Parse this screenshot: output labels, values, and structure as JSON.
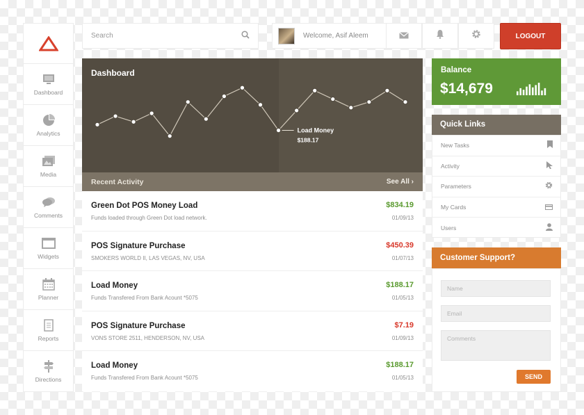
{
  "sidebar": {
    "items": [
      {
        "label": "Dashboard",
        "icon": "monitor-icon"
      },
      {
        "label": "Analytics",
        "icon": "pie-chart-icon"
      },
      {
        "label": "Media",
        "icon": "image-icon"
      },
      {
        "label": "Comments",
        "icon": "comments-icon"
      },
      {
        "label": "Widgets",
        "icon": "window-icon"
      },
      {
        "label": "Planner",
        "icon": "calendar-icon"
      },
      {
        "label": "Reports",
        "icon": "document-icon"
      },
      {
        "label": "Directions",
        "icon": "signpost-icon"
      }
    ]
  },
  "search": {
    "placeholder": "Search"
  },
  "user": {
    "welcome": "Welcome, Asif Aleem"
  },
  "header": {
    "logout_label": "LOGOUT"
  },
  "dashboard": {
    "title": "Dashboard",
    "tooltip_label": "Load Money",
    "tooltip_value": "$188.17"
  },
  "chart_data": {
    "type": "line",
    "series": [
      {
        "values": [
          40,
          55,
          45,
          60,
          20,
          80,
          50,
          90,
          105,
          75,
          30,
          65,
          100,
          85,
          70,
          80,
          100,
          80
        ]
      }
    ],
    "ylim": [
      0,
      120
    ],
    "highlight_index": 10,
    "grid": false
  },
  "recent": {
    "title": "Recent Activity",
    "see_all": "See All",
    "rows": [
      {
        "title": "Green Dot POS Money Load",
        "sub": "Funds loaded through Green Dot load network.",
        "amount": "$834.19",
        "date": "01/09/13",
        "color": "#5a9a2f"
      },
      {
        "title": "POS Signature Purchase",
        "sub": "SMOKERS WORLD II, LAS VEGAS, NV, USA",
        "amount": "$450.39",
        "date": "01/07/13",
        "color": "#d8382a"
      },
      {
        "title": "Load Money",
        "sub": "Funds Transfered From Bank Acount *5075",
        "amount": "$188.17",
        "date": "01/05/13",
        "color": "#5a9a2f"
      },
      {
        "title": "POS Signature Purchase",
        "sub": "VONS STORE 2511, HENDERSON, NV, USA",
        "amount": "$7.19",
        "date": "01/09/13",
        "color": "#d8382a"
      },
      {
        "title": "Load Money",
        "sub": "Funds Transfered From Bank Acount *5075",
        "amount": "$188.17",
        "date": "01/05/13",
        "color": "#5a9a2f"
      }
    ]
  },
  "balance": {
    "label": "Balance",
    "value": "$14,679",
    "mini_bars": [
      5,
      9,
      7,
      11,
      14,
      10,
      13,
      16,
      6,
      9
    ]
  },
  "quick_links": {
    "title": "Quick Links",
    "items": [
      {
        "label": "New Tasks",
        "icon": "bookmark-icon"
      },
      {
        "label": "Activity",
        "icon": "cursor-icon"
      },
      {
        "label": "Parameters",
        "icon": "gear-icon"
      },
      {
        "label": "My Cards",
        "icon": "card-icon"
      },
      {
        "label": "Users",
        "icon": "user-icon"
      }
    ]
  },
  "support": {
    "title": "Customer Support?",
    "name_placeholder": "Name",
    "email_placeholder": "Email",
    "comments_placeholder": "Comments",
    "send_label": "SEND"
  },
  "colors": {
    "accent_red": "#cf3f2a",
    "accent_green": "#5f9937",
    "accent_orange": "#d87b2f",
    "dashboard_bg": "#534c41"
  }
}
